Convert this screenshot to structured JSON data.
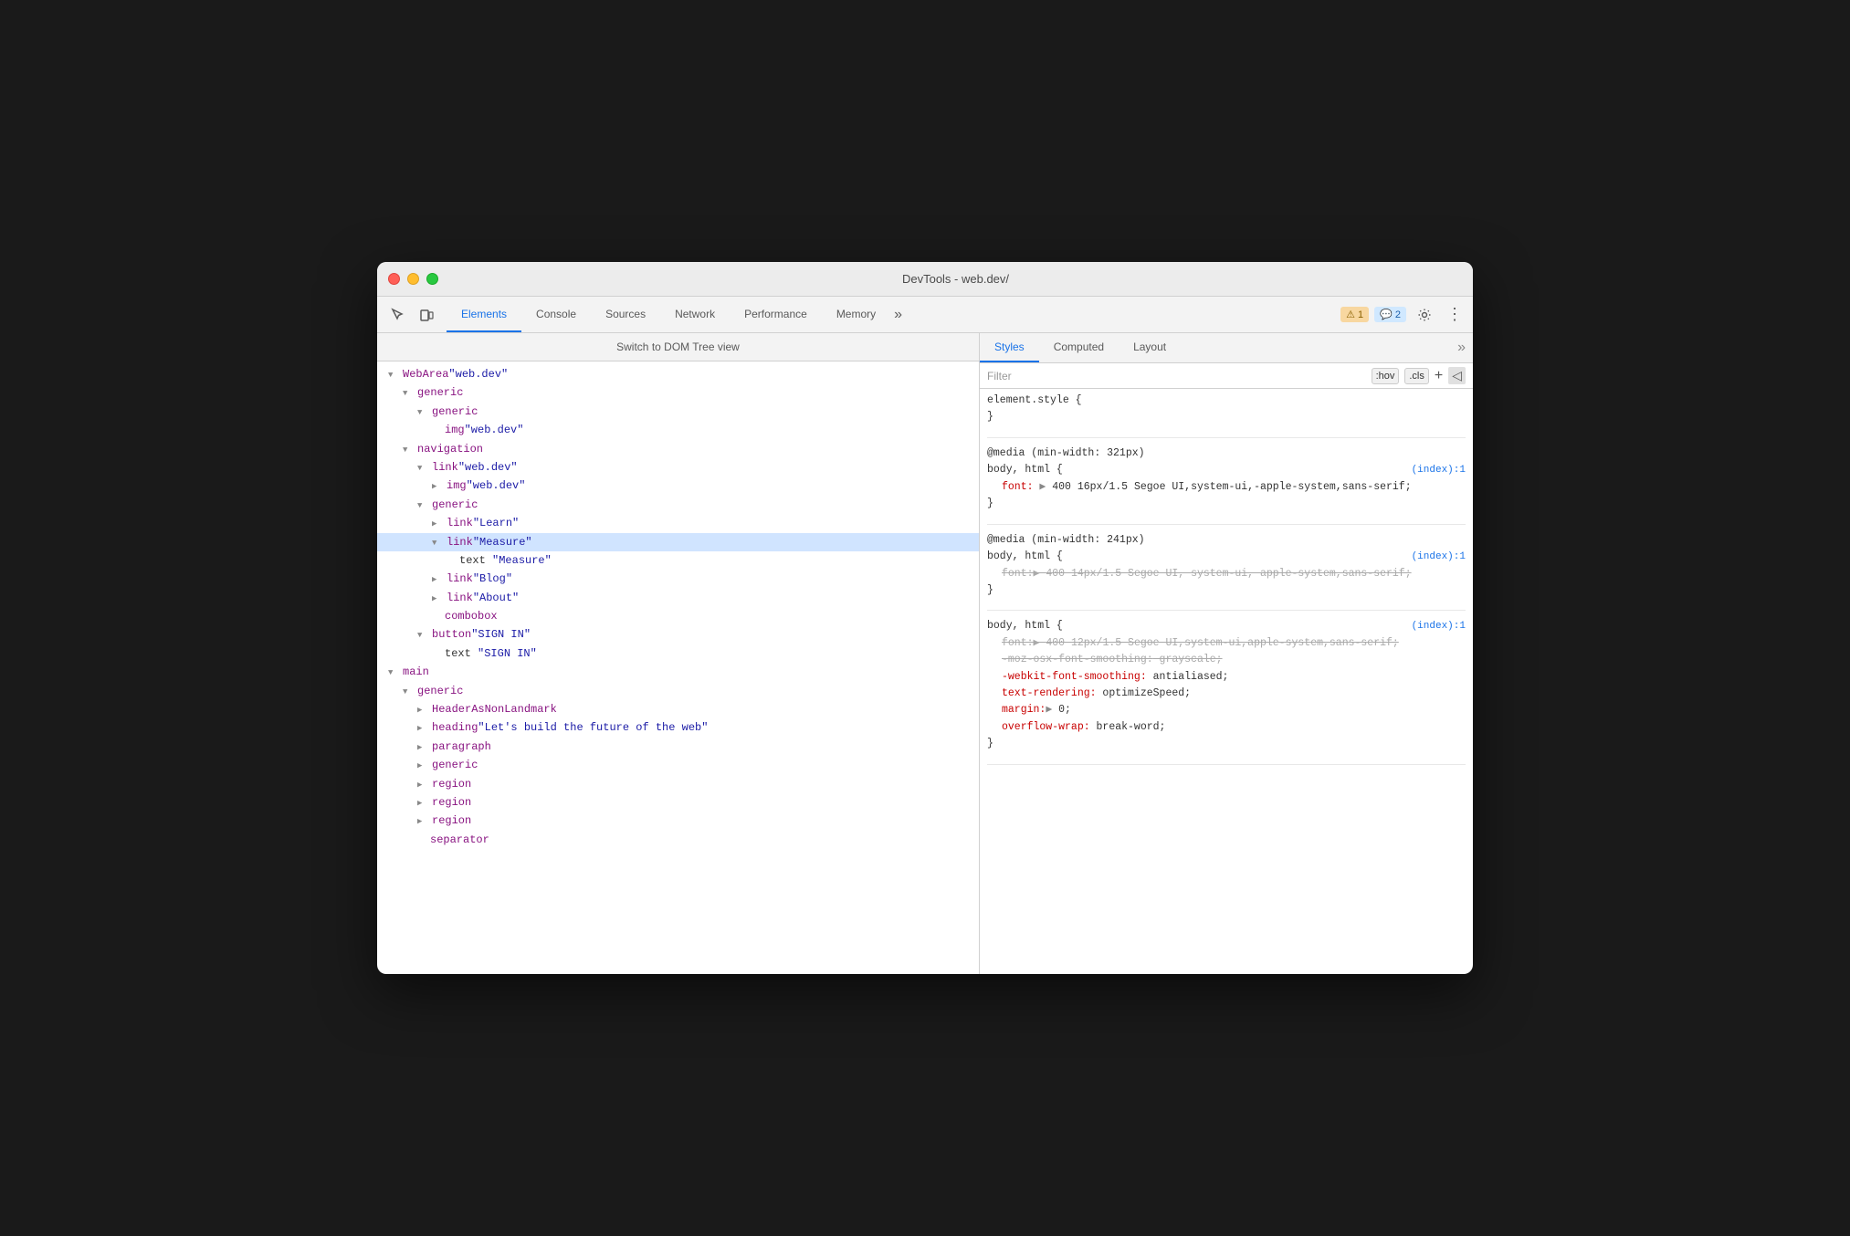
{
  "titlebar": {
    "title": "DevTools - web.dev/"
  },
  "toolbar": {
    "tabs": [
      {
        "id": "elements",
        "label": "Elements",
        "active": true
      },
      {
        "id": "console",
        "label": "Console"
      },
      {
        "id": "sources",
        "label": "Sources"
      },
      {
        "id": "network",
        "label": "Network"
      },
      {
        "id": "performance",
        "label": "Performance"
      },
      {
        "id": "memory",
        "label": "Memory"
      }
    ],
    "warning_badge": "⚠ 1",
    "message_badge": "💬 2",
    "overflow_icon": "≫"
  },
  "dom_panel": {
    "switch_bar_label": "Switch to DOM Tree view",
    "tree": [
      {
        "indent": 0,
        "expand": "▼",
        "node": "WebArea",
        "attr": "\"web.dev\""
      },
      {
        "indent": 1,
        "expand": "▼",
        "node": "generic",
        "attr": ""
      },
      {
        "indent": 2,
        "expand": "▼",
        "node": "generic",
        "attr": ""
      },
      {
        "indent": 3,
        "expand": "",
        "node": "img",
        "attr": "\"web.dev\""
      },
      {
        "indent": 1,
        "expand": "▼",
        "node": "navigation",
        "attr": ""
      },
      {
        "indent": 2,
        "expand": "▼",
        "node": "link",
        "attr": "\"web.dev\""
      },
      {
        "indent": 3,
        "expand": "▶",
        "node": "img",
        "attr": "\"web.dev\""
      },
      {
        "indent": 2,
        "expand": "▼",
        "node": "generic",
        "attr": ""
      },
      {
        "indent": 3,
        "expand": "▶",
        "node": "link",
        "attr": "\"Learn\""
      },
      {
        "indent": 3,
        "expand": "▼",
        "node": "link",
        "attr": "\"Measure\"",
        "selected": true
      },
      {
        "indent": 4,
        "expand": "",
        "node": "text",
        "attr": "\"Measure\""
      },
      {
        "indent": 3,
        "expand": "▶",
        "node": "link",
        "attr": "\"Blog\""
      },
      {
        "indent": 3,
        "expand": "▶",
        "node": "link",
        "attr": "\"About\""
      },
      {
        "indent": 3,
        "expand": "",
        "node": "combobox",
        "attr": ""
      },
      {
        "indent": 2,
        "expand": "▼",
        "node": "button",
        "attr": "\"SIGN IN\""
      },
      {
        "indent": 3,
        "expand": "",
        "node": "text",
        "attr": "\"SIGN IN\""
      },
      {
        "indent": 0,
        "expand": "▼",
        "node": "main",
        "attr": ""
      },
      {
        "indent": 1,
        "expand": "▼",
        "node": "generic",
        "attr": ""
      },
      {
        "indent": 2,
        "expand": "▶",
        "node": "HeaderAsNonLandmark",
        "attr": ""
      },
      {
        "indent": 2,
        "expand": "▶",
        "node": "heading",
        "attr": "\"Let's build the future of the web\""
      },
      {
        "indent": 2,
        "expand": "▶",
        "node": "paragraph",
        "attr": ""
      },
      {
        "indent": 2,
        "expand": "▶",
        "node": "generic",
        "attr": ""
      },
      {
        "indent": 2,
        "expand": "▶",
        "node": "region",
        "attr": ""
      },
      {
        "indent": 2,
        "expand": "▶",
        "node": "region",
        "attr": ""
      },
      {
        "indent": 2,
        "expand": "▶",
        "node": "region",
        "attr": ""
      },
      {
        "indent": 2,
        "expand": "",
        "node": "separator",
        "attr": ""
      }
    ]
  },
  "styles_panel": {
    "tabs": [
      {
        "id": "styles",
        "label": "Styles",
        "active": true
      },
      {
        "id": "computed",
        "label": "Computed"
      },
      {
        "id": "layout",
        "label": "Layout"
      }
    ],
    "filter_placeholder": "Filter",
    "filter_hov": ":hov",
    "filter_cls": ".cls",
    "rules": [
      {
        "id": "element_style",
        "selector": "element.style {",
        "closing": "}",
        "properties": []
      },
      {
        "id": "media_321",
        "media": "@media (min-width: 321px)",
        "selector": "body, html {",
        "source": "(index):1",
        "closing": "}",
        "properties": [
          {
            "name": "font:",
            "triangle": "▶",
            "value": "400 16px/1.5 Segoe UI,system-ui,-apple-system,sans-serif;",
            "strikethrough": false
          }
        ]
      },
      {
        "id": "media_241",
        "media": "@media (min-width: 241px)",
        "selector": "body, html {",
        "source": "(index):1",
        "closing": "}",
        "properties": [
          {
            "name": "font:",
            "triangle": "▶",
            "value": "400 14px/1.5 Segoe UI, system-ui, apple-system,sans-serif;",
            "strikethrough": true
          }
        ]
      },
      {
        "id": "body_html_3",
        "selector": "body, html {",
        "source": "(index):1",
        "closing": "}",
        "properties": [
          {
            "name": "font:",
            "triangle": "▶",
            "value": "400 12px/1.5 Segoe UI,system-ui,apple-system,sans-serif;",
            "strikethrough": true
          },
          {
            "name": "-moz-osx-font-smoothing:",
            "value": "grayscale;",
            "strikethrough": true
          },
          {
            "name": "-webkit-font-smoothing:",
            "value": "antialiased;",
            "strikethrough": false,
            "nameRed": true
          },
          {
            "name": "text-rendering:",
            "value": "optimizeSpeed;",
            "strikethrough": false,
            "nameRed": true
          },
          {
            "name": "margin:",
            "triangle": "▶",
            "value": "0;",
            "strikethrough": false,
            "nameRed": true
          },
          {
            "name": "overflow-wrap:",
            "value": "break-word;",
            "strikethrough": false,
            "nameRed": true,
            "partial": true
          }
        ]
      }
    ]
  }
}
